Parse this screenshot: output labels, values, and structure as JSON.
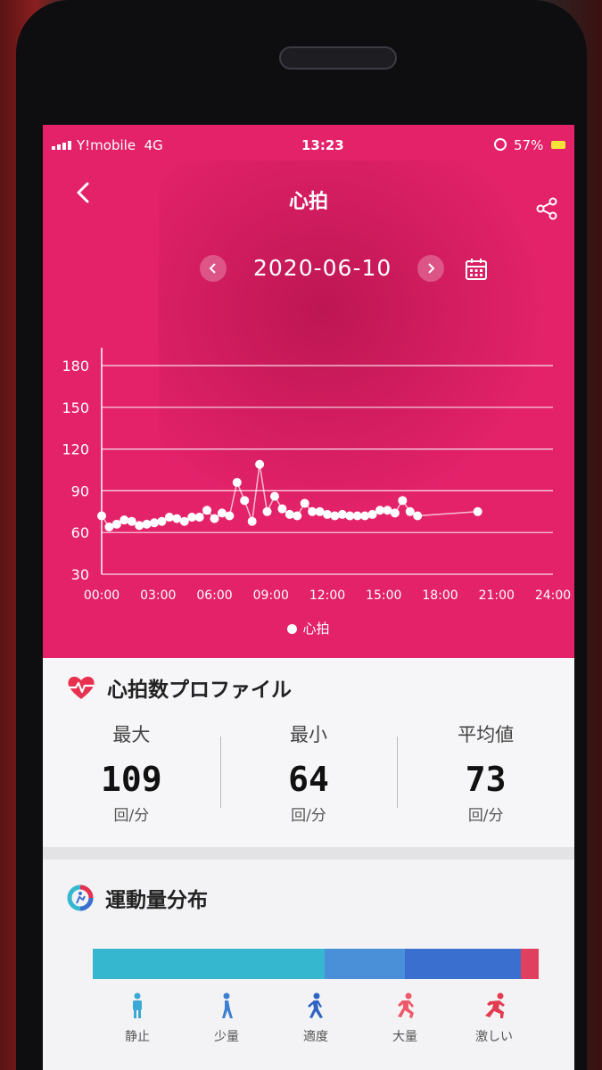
{
  "status_bar": {
    "carrier": "Y!mobile",
    "network": "4G",
    "time": "13:23",
    "battery": "57%"
  },
  "nav": {
    "title": "心拍",
    "back_icon": "chevron-left-icon",
    "share_icon": "share-icon"
  },
  "date_selector": {
    "date": "2020-06-10",
    "prev_icon": "chevron-left-icon",
    "next_icon": "chevron-right-icon",
    "calendar_icon": "calendar-icon"
  },
  "chart_data": {
    "type": "scatter",
    "title": "",
    "xlabel": "",
    "ylabel": "",
    "x_ticks": [
      "00:00",
      "03:00",
      "06:00",
      "09:00",
      "12:00",
      "15:00",
      "18:00",
      "21:00",
      "24:00"
    ],
    "y_ticks": [
      30,
      60,
      90,
      120,
      150,
      180
    ],
    "ylim": [
      30,
      180
    ],
    "xlim_hours": [
      0,
      24
    ],
    "grid": true,
    "legend": "bottom-center",
    "series": [
      {
        "name": "心拍",
        "color": "#ffffff",
        "points": [
          [
            0.0,
            72
          ],
          [
            0.4,
            64
          ],
          [
            0.8,
            66
          ],
          [
            1.2,
            69
          ],
          [
            1.6,
            68
          ],
          [
            2.0,
            65
          ],
          [
            2.4,
            66
          ],
          [
            2.8,
            67
          ],
          [
            3.2,
            68
          ],
          [
            3.6,
            71
          ],
          [
            4.0,
            70
          ],
          [
            4.4,
            68
          ],
          [
            4.8,
            71
          ],
          [
            5.2,
            71
          ],
          [
            5.6,
            76
          ],
          [
            6.0,
            70
          ],
          [
            6.4,
            74
          ],
          [
            6.8,
            72
          ],
          [
            7.2,
            96
          ],
          [
            7.6,
            83
          ],
          [
            8.0,
            68
          ],
          [
            8.4,
            109
          ],
          [
            8.8,
            75
          ],
          [
            9.2,
            86
          ],
          [
            9.6,
            77
          ],
          [
            10.0,
            73
          ],
          [
            10.4,
            72
          ],
          [
            10.8,
            81
          ],
          [
            11.2,
            75
          ],
          [
            11.6,
            75
          ],
          [
            12.0,
            73
          ],
          [
            12.4,
            72
          ],
          [
            12.8,
            73
          ],
          [
            13.2,
            72
          ],
          [
            13.6,
            72
          ],
          [
            14.0,
            72
          ],
          [
            14.4,
            73
          ],
          [
            14.8,
            76
          ],
          [
            15.2,
            76
          ],
          [
            15.6,
            74
          ],
          [
            16.0,
            83
          ],
          [
            16.4,
            75
          ],
          [
            16.8,
            72
          ],
          [
            20.0,
            75
          ]
        ]
      }
    ]
  },
  "profile": {
    "title": "心拍数プロファイル",
    "icon": "heart-pulse-icon",
    "stats": [
      {
        "label": "最大",
        "value": "109",
        "unit": "回/分"
      },
      {
        "label": "最小",
        "value": "64",
        "unit": "回/分"
      },
      {
        "label": "平均値",
        "value": "73",
        "unit": "回/分"
      }
    ]
  },
  "activity": {
    "title": "運動量分布",
    "icon": "activity-ring-icon",
    "distribution": [
      {
        "level": "静止",
        "fraction": 0.52,
        "color": "#35b8cf"
      },
      {
        "level": "少量",
        "fraction": 0.18,
        "color": "#4a90d9"
      },
      {
        "level": "適度",
        "fraction": 0.26,
        "color": "#3a6fcf"
      },
      {
        "level": "大量",
        "fraction": 0.0,
        "color": "#ef5a7a"
      },
      {
        "level": "激しい",
        "fraction": 0.04,
        "color": "#e0405f"
      }
    ],
    "levels": [
      {
        "label": "静止",
        "icon": "standing-person-icon",
        "color": "#3aa9d6"
      },
      {
        "label": "少量",
        "icon": "walking-person-icon",
        "color": "#3d7fd2"
      },
      {
        "label": "適度",
        "icon": "brisk-walking-icon",
        "color": "#3064c4"
      },
      {
        "label": "大量",
        "icon": "running-person-icon",
        "color": "#ef5a6a"
      },
      {
        "label": "激しい",
        "icon": "sprinting-person-icon",
        "color": "#e23b50"
      }
    ]
  }
}
